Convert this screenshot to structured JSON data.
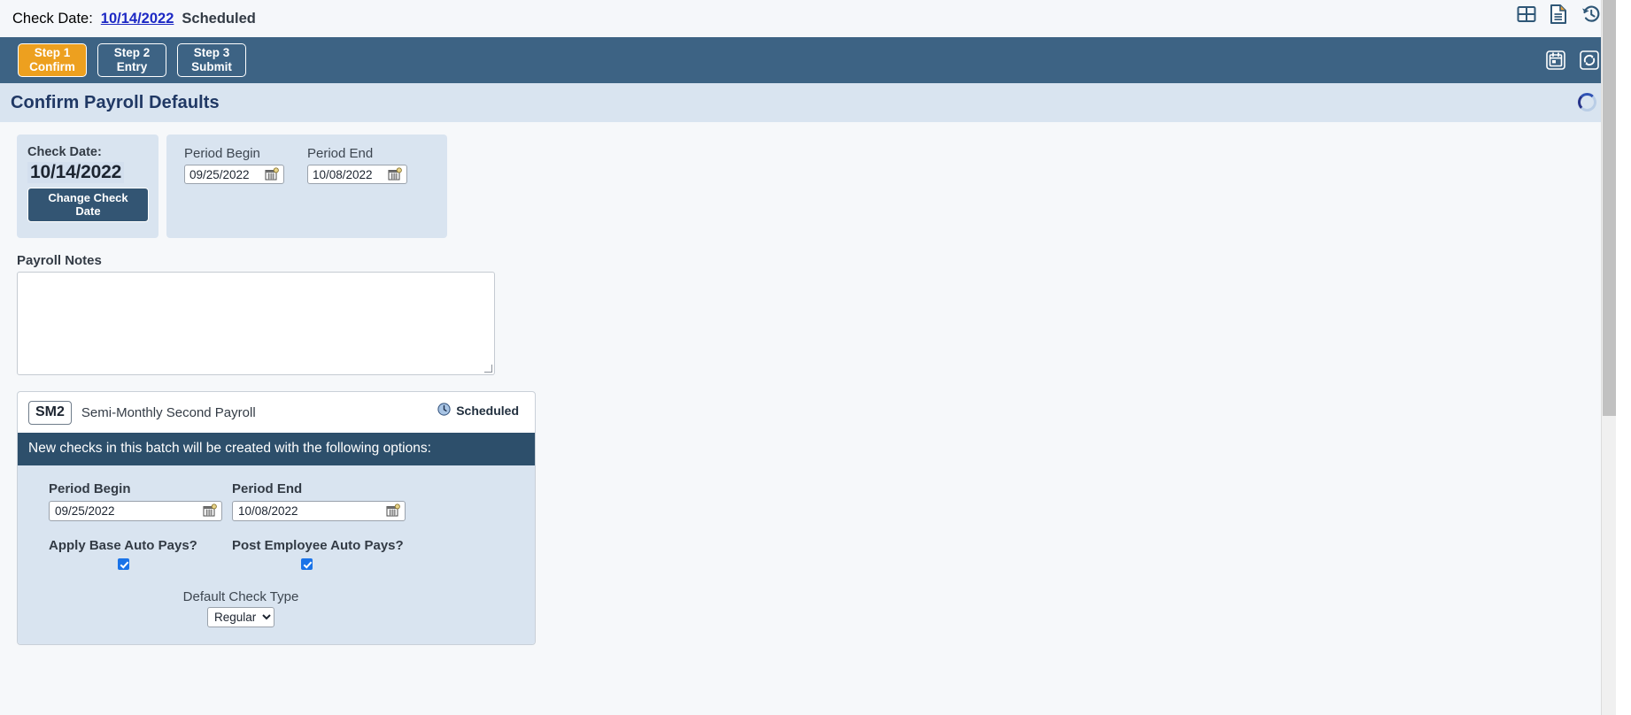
{
  "topbar": {
    "label": "Check Date:",
    "date": "10/14/2022",
    "status": "Scheduled",
    "icons": [
      "grid-table-icon",
      "document-icon",
      "history-icon"
    ]
  },
  "steps": {
    "items": [
      {
        "top": "Step 1",
        "bottom": "Confirm",
        "active": true
      },
      {
        "top": "Step 2",
        "bottom": "Entry",
        "active": false
      },
      {
        "top": "Step 3",
        "bottom": "Submit",
        "active": false
      }
    ],
    "icons": [
      "calendar-icon",
      "refresh-icon"
    ]
  },
  "header": {
    "title": "Confirm Payroll Defaults",
    "loading": true
  },
  "check_date_card": {
    "label": "Check Date:",
    "value": "10/14/2022",
    "button": "Change Check Date"
  },
  "periods_card": {
    "begin_label": "Period Begin",
    "begin_value": "09/25/2022",
    "end_label": "Period End",
    "end_value": "10/08/2022"
  },
  "notes": {
    "label": "Payroll Notes",
    "value": "",
    "placeholder": ""
  },
  "batch": {
    "code": "SM2",
    "name": "Semi-Monthly Second Payroll",
    "status": "Scheduled",
    "banner": "New checks in this batch will be created with the following options:",
    "begin_label": "Period Begin",
    "begin_value": "09/25/2022",
    "end_label": "Period End",
    "end_value": "10/08/2022",
    "apply_base_label": "Apply Base Auto Pays?",
    "apply_base_checked": true,
    "post_employee_label": "Post Employee Auto Pays?",
    "post_employee_checked": true,
    "default_check_type_label": "Default Check Type",
    "default_check_type_value": "Regular",
    "default_check_type_options": [
      "Regular"
    ]
  },
  "colors": {
    "toolbar": "#3d6384",
    "accent_orange": "#eda01f",
    "banner_navy": "#2d4f6b",
    "panel_blue": "#d9e4f0",
    "link_blue": "#1d29c4",
    "checkbox_blue": "#1a73e8"
  }
}
